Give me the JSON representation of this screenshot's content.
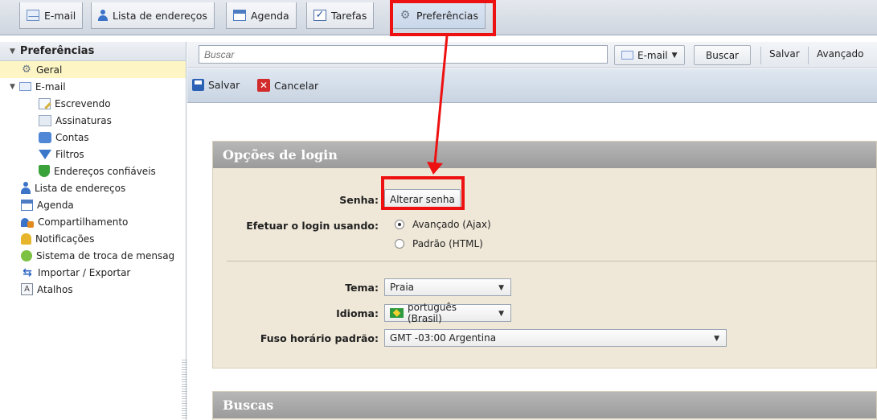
{
  "app_tabs": [
    {
      "label": "E-mail"
    },
    {
      "label": "Lista de endereços"
    },
    {
      "label": "Agenda"
    },
    {
      "label": "Tarefas"
    },
    {
      "label": "Preferências"
    }
  ],
  "sidebar": {
    "title": "Preferências",
    "items": [
      {
        "label": "Geral",
        "selected": true,
        "icon": "gear-icon"
      },
      {
        "label": "E-mail",
        "icon": "mail-icon"
      },
      {
        "label": "Escrevendo",
        "icon": "compose-icon"
      },
      {
        "label": "Assinaturas",
        "icon": "signature-icon"
      },
      {
        "label": "Contas",
        "icon": "accounts-icon"
      },
      {
        "label": "Filtros",
        "icon": "filter-icon"
      },
      {
        "label": "Endereços confiáveis",
        "icon": "shield-icon"
      },
      {
        "label": "Lista de endereços",
        "icon": "person-icon"
      },
      {
        "label": "Agenda",
        "icon": "calendar-icon"
      },
      {
        "label": "Compartilhamento",
        "icon": "share-icon"
      },
      {
        "label": "Notificações",
        "icon": "bell-icon"
      },
      {
        "label": "Sistema de troca de mensag",
        "icon": "chat-icon"
      },
      {
        "label": "Importar / Exportar",
        "icon": "import-export-icon"
      },
      {
        "label": "Atalhos",
        "icon": "keyboard-icon"
      }
    ]
  },
  "search": {
    "placeholder": "Buscar",
    "scope": "E-mail",
    "search_button": "Buscar",
    "save_link": "Salvar",
    "advanced_link": "Avançado"
  },
  "actions": {
    "save": "Salvar",
    "cancel": "Cancelar"
  },
  "login_section": {
    "title": "Opções de login",
    "password_label": "Senha:",
    "change_password_button": "Alterar senha",
    "login_using_label": "Efetuar o login usando:",
    "options": [
      "Avançado (Ajax)",
      "Padrão (HTML)"
    ],
    "selected_option": "Avançado (Ajax)",
    "theme_label": "Tema:",
    "theme_value": "Praia",
    "language_label": "Idioma:",
    "language_value": "português (Brasil)",
    "timezone_label": "Fuso horário padrão:",
    "timezone_value": "GMT -03:00 Argentina"
  },
  "search_section": {
    "title": "Buscas"
  },
  "colors": {
    "annotation": "#ee1111",
    "section_bg": "#efe8d8",
    "selected_row": "#fdf6c4"
  }
}
